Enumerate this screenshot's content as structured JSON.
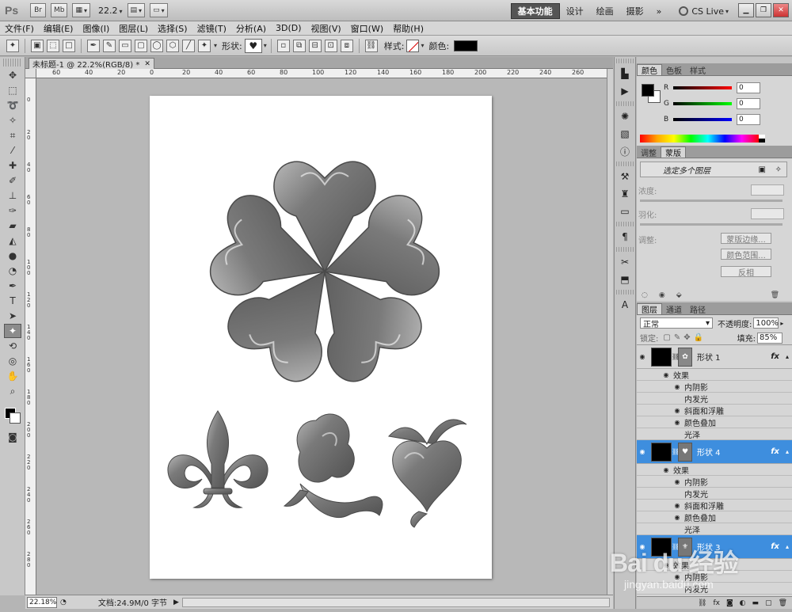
{
  "titlebar": {
    "app_logo": "Ps",
    "br_label": "Br",
    "mb_label": "Mb",
    "zoom_value": "22.2",
    "workspaces": [
      "基本功能",
      "设计",
      "绘画",
      "摄影"
    ],
    "more": "»",
    "cslive": "CS Live"
  },
  "menu": [
    "文件(F)",
    "编辑(E)",
    "图像(I)",
    "图层(L)",
    "选择(S)",
    "滤镜(T)",
    "分析(A)",
    "3D(D)",
    "视图(V)",
    "窗口(W)",
    "帮助(H)"
  ],
  "options": {
    "shape_label": "形状:",
    "style_label": "样式:",
    "color_label": "颜色:",
    "color_value": "#000000"
  },
  "document": {
    "tab_title": "未标题-1 @ 22.2%(RGB/8) *",
    "ruler_h_labels": [
      "60",
      "40",
      "20",
      "0",
      "20",
      "40",
      "60",
      "80",
      "100",
      "120",
      "140",
      "160",
      "180",
      "200",
      "220",
      "240",
      "260"
    ],
    "ruler_v_labels": [
      "0",
      "2 0",
      "4 0",
      "6 0",
      "8 0",
      "1 0 0",
      "1 2 0",
      "1 4 0",
      "1 6 0",
      "1 8 0",
      "2 0 0",
      "2 2 0",
      "2 4 0",
      "2 6 0",
      "2 8 0"
    ]
  },
  "status": {
    "zoom": "22.18%",
    "doc_info": "文档:24.9M/0 字节"
  },
  "color_panel": {
    "tabs": [
      "颜色",
      "色板",
      "样式"
    ],
    "channels": [
      {
        "label": "R",
        "value": "0",
        "gradient": "linear-gradient(90deg,#000,#f00)"
      },
      {
        "label": "G",
        "value": "0",
        "gradient": "linear-gradient(90deg,#000,#0f0)"
      },
      {
        "label": "B",
        "value": "0",
        "gradient": "linear-gradient(90deg,#000,#00f)"
      }
    ]
  },
  "mask_panel": {
    "tabs": [
      "调整",
      "蒙版"
    ],
    "header": "选定多个图层",
    "density_label": "浓度:",
    "feather_label": "羽化:",
    "adjust_label": "调整:",
    "btn_edge": "蒙版边缘...",
    "btn_range": "颜色范围...",
    "btn_invert": "反相"
  },
  "layers_panel": {
    "tabs": [
      "图层",
      "通道",
      "路径"
    ],
    "blend_mode": "正常",
    "opacity_label": "不透明度:",
    "opacity": "100%",
    "lock_label": "锁定:",
    "fill_label": "填充:",
    "fill": "85%",
    "fx": "fx",
    "layers": [
      {
        "name": "形状 1",
        "selected": false,
        "effects_title": "效果",
        "effects": [
          {
            "name": "内阴影",
            "visible": true
          },
          {
            "name": "内发光",
            "visible": false
          },
          {
            "name": "斜面和浮雕",
            "visible": true
          },
          {
            "name": "颜色叠加",
            "visible": true
          },
          {
            "name": "光泽",
            "visible": false
          }
        ]
      },
      {
        "name": "形状 4",
        "selected": true,
        "effects_title": "效果",
        "effects": [
          {
            "name": "内阴影",
            "visible": true
          },
          {
            "name": "内发光",
            "visible": false
          },
          {
            "name": "斜面和浮雕",
            "visible": true
          },
          {
            "name": "颜色叠加",
            "visible": true
          },
          {
            "name": "光泽",
            "visible": false
          }
        ]
      },
      {
        "name": "形状 3",
        "selected": true,
        "effects_title": "效果",
        "effects": [
          {
            "name": "内阴影",
            "visible": true
          },
          {
            "name": "内发光",
            "visible": false
          }
        ]
      }
    ]
  },
  "watermark": {
    "logo": "Bai du 经验",
    "url": "jingyan.baidu.com"
  }
}
